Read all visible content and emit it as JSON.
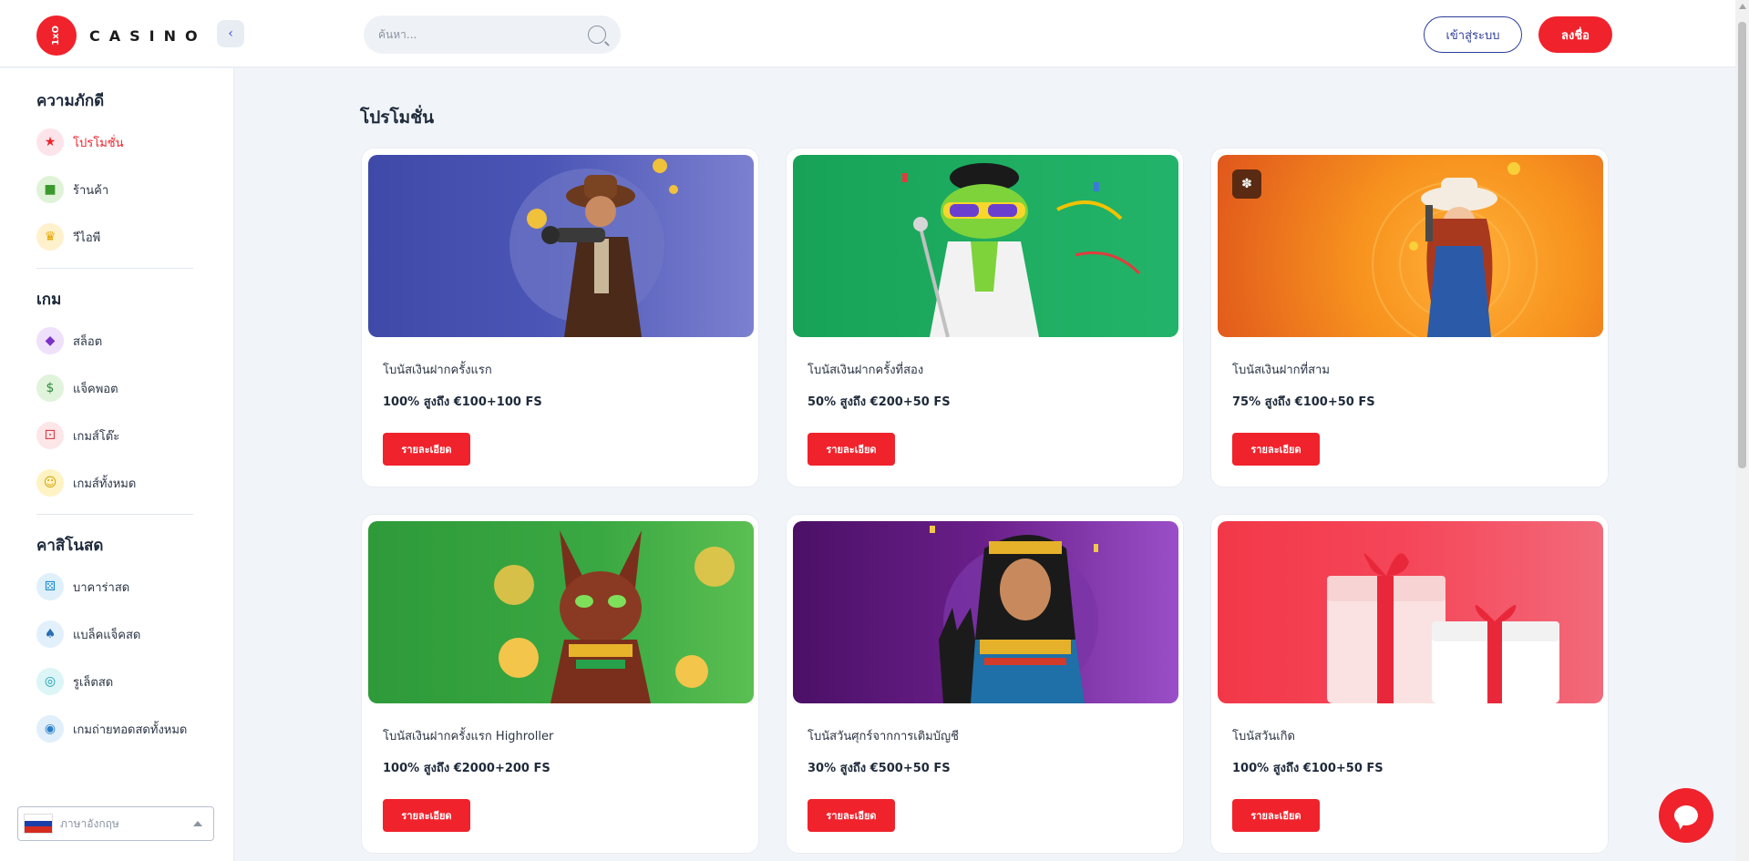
{
  "header": {
    "logo_mark": "1xO",
    "logo_text": "CASINO",
    "collapse_icon": "chevron-left-icon",
    "search_placeholder": "ค้นหา...",
    "login_label": "เข้าสู่ระบบ",
    "register_label": "ลงชื่อ"
  },
  "sidebar": {
    "sections": [
      {
        "heading": "ความภักดี",
        "items": [
          {
            "label": "โปรโมชั่น",
            "icon": "promo-icon",
            "active": true
          },
          {
            "label": "ร้านค้า",
            "icon": "shop-icon",
            "active": false
          },
          {
            "label": "วีไอพี",
            "icon": "vip-icon",
            "active": false
          }
        ]
      },
      {
        "heading": "เกม",
        "items": [
          {
            "label": "สล็อต",
            "icon": "slots-icon"
          },
          {
            "label": "แจ็คพอต",
            "icon": "jackpot-icon"
          },
          {
            "label": "เกมส์โต๊ะ",
            "icon": "table-games-icon"
          },
          {
            "label": "เกมส์ทั้งหมด",
            "icon": "all-games-icon"
          }
        ]
      },
      {
        "heading": "คาสิโนสด",
        "items": [
          {
            "label": "บาคาร่าสด",
            "icon": "baccarat-icon"
          },
          {
            "label": "แบล็คแจ็คสด",
            "icon": "blackjack-icon"
          },
          {
            "label": "รูเล็ตสด",
            "icon": "roulette-icon"
          },
          {
            "label": "เกมถ่ายทอดสดทั้งหมด",
            "icon": "live-games-icon"
          }
        ]
      }
    ],
    "language": "ภาษาอังกฤษ"
  },
  "main": {
    "title": "โปรโมชั่น",
    "cards": [
      {
        "title": "โบนัสเงินฝากครั้งแรก",
        "desc": "100% สูงถึง €100+100 FS",
        "button": "รายละเอียด"
      },
      {
        "title": "โบนัสเงินฝากครั้งที่สอง",
        "desc": "50% สูงถึง €200+50 FS",
        "button": "รายละเอียด"
      },
      {
        "title": "โบนัสเงินฝากที่สาม",
        "desc": "75% สูงถึง €100+50 FS",
        "button": "รายละเอียด"
      },
      {
        "title": "โบนัสเงินฝากครั้งแรก Highroller",
        "desc": "100% สูงถึง €2000+200 FS",
        "button": "รายละเอียด"
      },
      {
        "title": "โบนัสวันศุกร์จากการเติมบัญชี",
        "desc": "30% สูงถึง €500+50 FS",
        "button": "รายละเอียด"
      },
      {
        "title": "โบนัสวันเกิด",
        "desc": "100% สูงถึง €100+50 FS",
        "button": "รายละเอียด"
      }
    ]
  },
  "colors": {
    "accent": "#f0222b",
    "login_border": "#2e3e9a"
  }
}
